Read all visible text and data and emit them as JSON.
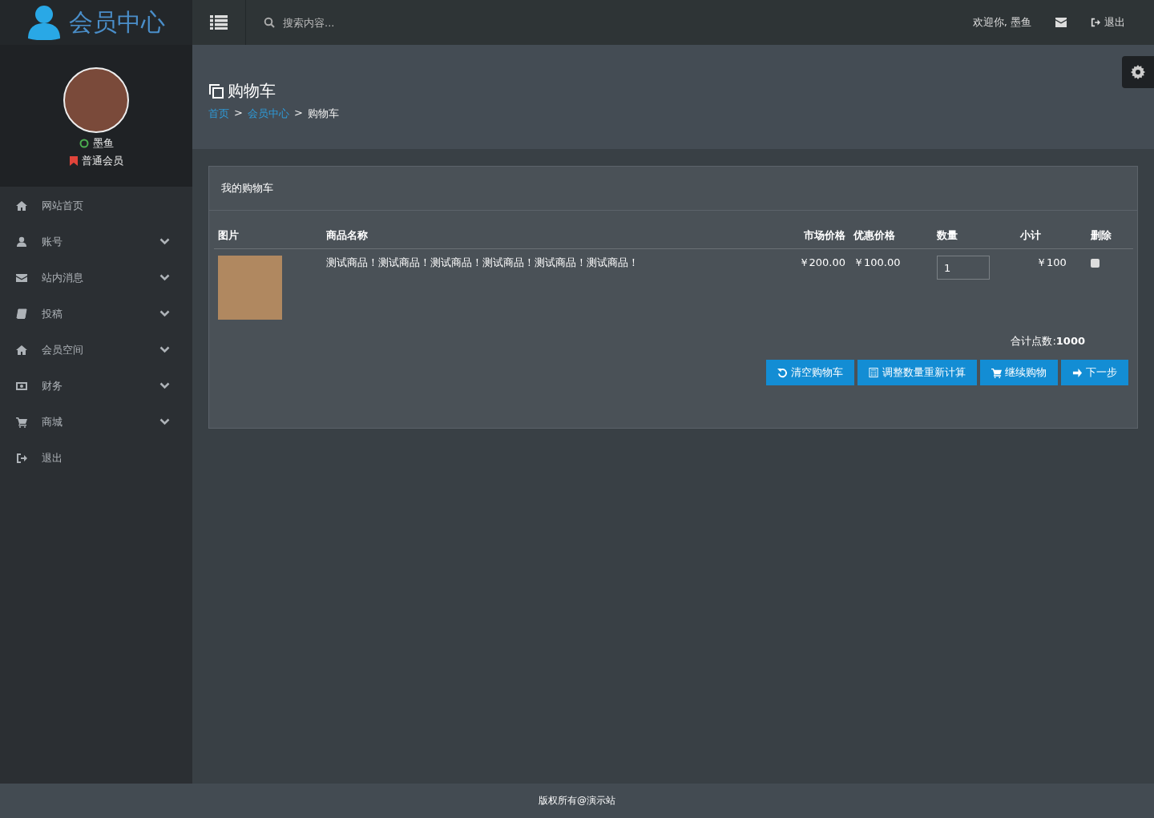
{
  "header": {
    "logo": "会员中心",
    "search": {
      "placeholder": "搜索内容..."
    },
    "welcome": "欢迎你, 墨鱼",
    "logout": "退出"
  },
  "profile": {
    "name": "墨鱼",
    "online": true,
    "level": "普通会员"
  },
  "sidebar": {
    "items": [
      {
        "label": "网站首页",
        "kind": "link"
      },
      {
        "label": "账号",
        "kind": "menu",
        "expanded": false
      },
      {
        "label": "站内消息",
        "kind": "menu",
        "expanded": false
      },
      {
        "label": "投稿",
        "kind": "menu",
        "expanded": false
      },
      {
        "label": "会员空间",
        "kind": "menu",
        "expanded": false
      },
      {
        "label": "财务",
        "kind": "menu",
        "expanded": false
      },
      {
        "label": "商城",
        "kind": "menu",
        "expanded": false
      },
      {
        "label": "退出",
        "kind": "link"
      }
    ]
  },
  "page": {
    "title": "购物车",
    "breadcrumb": [
      {
        "label": "首页",
        "link": true
      },
      {
        "label": "会员中心",
        "link": true
      },
      {
        "label": "购物车",
        "link": false
      }
    ],
    "separator": ">"
  },
  "cart": {
    "title": "我的购物车",
    "columns": [
      "图片",
      "商品名称",
      "市场价格",
      "优惠价格",
      "数量",
      "小计",
      "删除"
    ],
    "rows": [
      {
        "name": "测试商品！测试商品！测试商品！测试商品！测试商品！测试商品！",
        "market_price": "￥200.00",
        "sale_price": "￥100.00",
        "quantity": "1",
        "subtotal": "￥100",
        "delete_checked": false
      }
    ],
    "total_label": "合计点数:",
    "total": "1000",
    "buttons": [
      "清空购物车",
      "调整数量重新计算",
      "继续购物",
      "下一步"
    ]
  },
  "footer": "版权所有@演示站"
}
